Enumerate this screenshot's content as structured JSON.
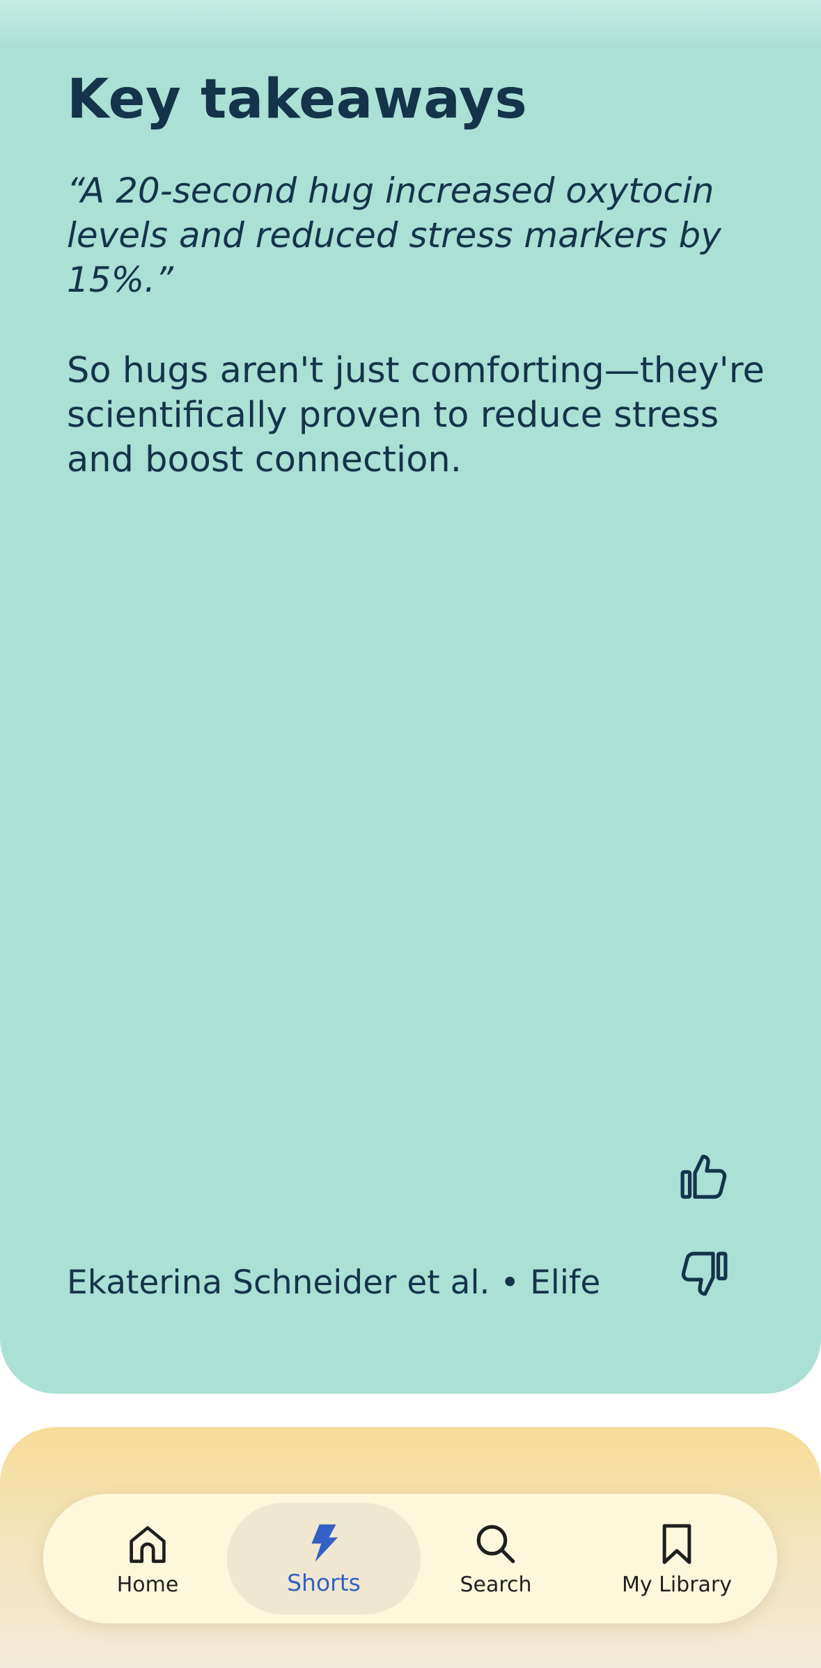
{
  "card": {
    "title": "Key takeaways",
    "quote": "“A 20-second hug increased oxytocin levels and reduced stress markers by 15%.”",
    "summary": "So hugs aren't just comforting—they're scientifically proven to reduce stress and boost connection.",
    "attribution": "Ekaterina Schneider et al. • Elife",
    "feedback": {
      "like_icon": "thumbs-up-icon",
      "dislike_icon": "thumbs-down-icon"
    }
  },
  "nav": {
    "items": [
      {
        "label": "Home",
        "icon": "home-icon",
        "active": false
      },
      {
        "label": "Shorts",
        "icon": "lightning-icon",
        "active": true
      },
      {
        "label": "Search",
        "icon": "search-icon",
        "active": false
      },
      {
        "label": "My Library",
        "icon": "bookmark-icon",
        "active": false
      }
    ]
  },
  "colors": {
    "card_bg": "#abe0d5",
    "text": "#14344a",
    "next_card": "#f7dc98",
    "nav_bg": "#fdf8dc",
    "active_accent": "#3360c4"
  }
}
